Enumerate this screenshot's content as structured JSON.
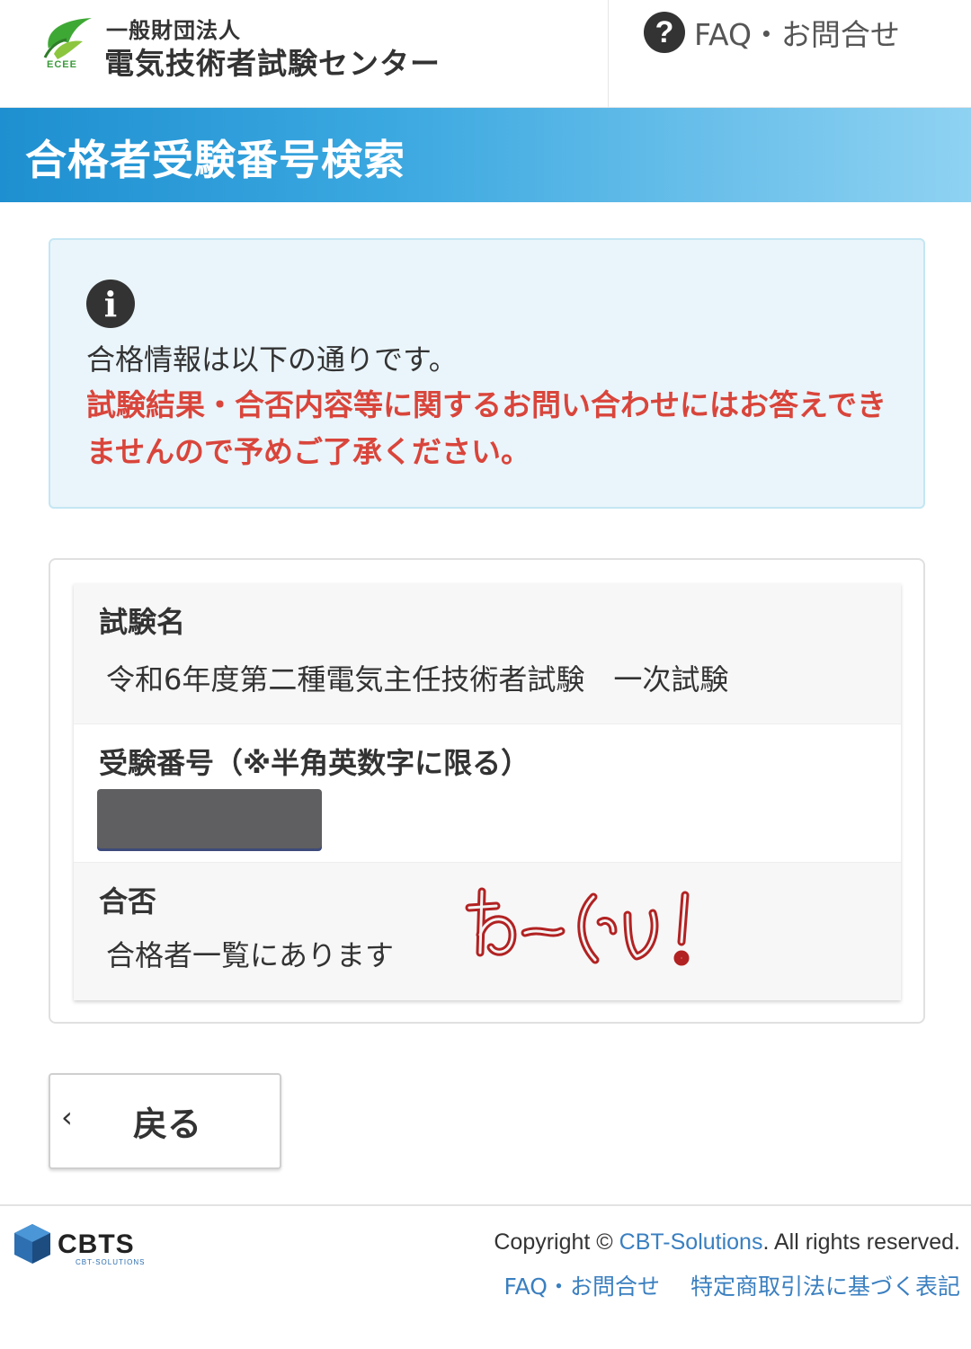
{
  "header": {
    "logo_caption": "ECEE",
    "org_small": "一般財団法人",
    "org_large": "電気技術者試験センター",
    "faq_icon": "question-circle-icon",
    "faq_label": "FAQ・お問合せ"
  },
  "banner": {
    "title": "合格者受験番号検索"
  },
  "info": {
    "icon": "info-circle-icon",
    "message": "合格情報は以下の通りです。",
    "warning": "試験結果・合否内容等に関するお問い合わせにはお答えできませんので予めご了承ください。",
    "warning_color": "#d9453b"
  },
  "result": {
    "exam_label": "試験名",
    "exam_value": "令和6年度第二種電気主任技術者試験　一次試験",
    "number_label": "受験番号（※半角英数字に限る）",
    "pass_label": "合否",
    "pass_value": "合格者一覧にあります",
    "handwriting": "わーい!"
  },
  "back_button": {
    "label": "戻る"
  },
  "footer": {
    "logo_text": "CBTS",
    "logo_sub": "CBT-SOLUTIONS",
    "copyright_prefix": "Copyright © ",
    "copyright_brand": "CBT-Solutions",
    "copyright_suffix": ". All rights reserved.",
    "link_faq": "FAQ・お問合せ",
    "link_law": "特定商取引法に基づく表記"
  },
  "colors": {
    "banner": "#1e8fd0",
    "info_bg": "#eaf5fb",
    "link": "#3a7fc0"
  }
}
